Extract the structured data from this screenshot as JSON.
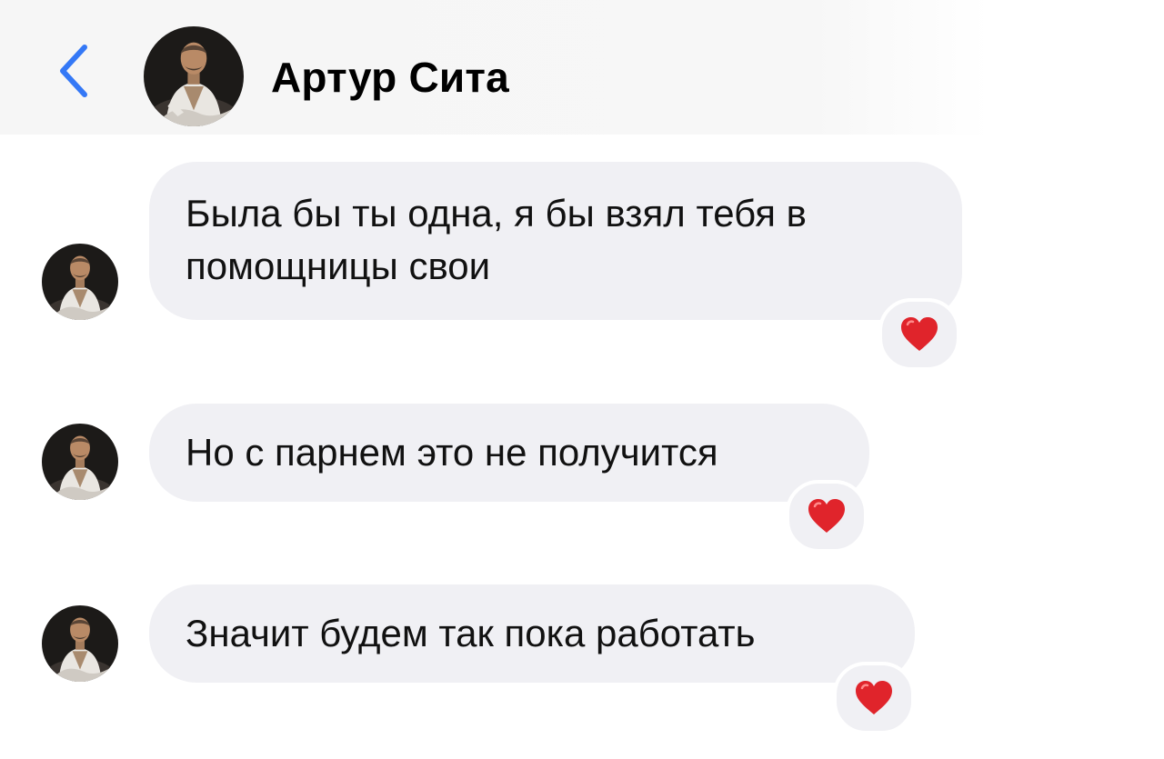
{
  "header": {
    "contact_name": "Артур Сита",
    "back_icon": "chevron-left-icon",
    "accent_color": "#3478f6"
  },
  "messages": [
    {
      "lines": [
        "Была бы ты одна, я бы взял тебя в",
        "помощницы свои"
      ],
      "reaction": "heart-icon"
    },
    {
      "lines": [
        "Но с парнем это не получится"
      ],
      "reaction": "heart-icon"
    },
    {
      "lines": [
        "Значит будем так пока работать"
      ],
      "reaction": "heart-icon"
    }
  ],
  "colors": {
    "bubble": "#f0f0f4",
    "heart": "#e0242b",
    "header_bg": "#f6f6f6"
  }
}
